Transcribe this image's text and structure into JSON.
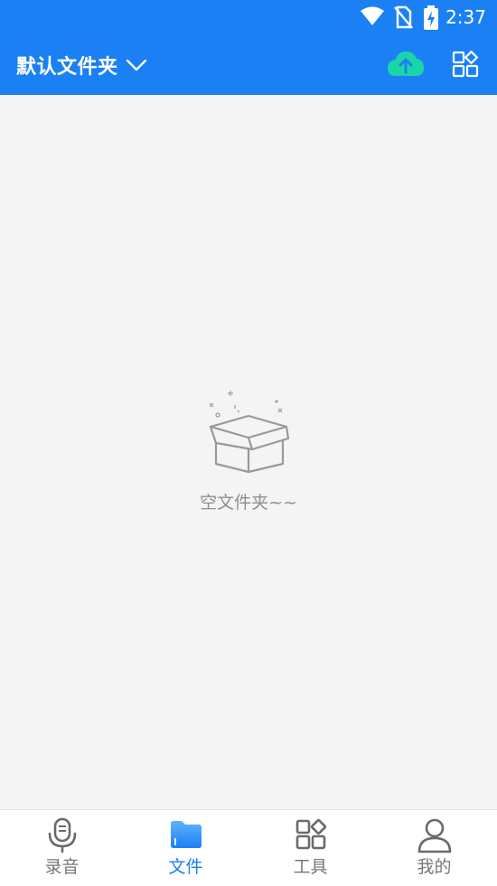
{
  "status_bar": {
    "time": "2:37",
    "icons": [
      "wifi-icon",
      "no-sim-icon",
      "battery-charging-icon"
    ]
  },
  "app_bar": {
    "folder_title": "默认文件夹",
    "actions": [
      {
        "icon": "cloud-upload-icon",
        "color": "#1ad6a6"
      },
      {
        "icon": "apps-grid-icon"
      }
    ]
  },
  "empty_state": {
    "message": "空文件夹~~",
    "icon": "empty-box-icon"
  },
  "bottom_nav": {
    "items": [
      {
        "label": "录音",
        "icon": "microphone-icon",
        "active": false
      },
      {
        "label": "文件",
        "icon": "folder-icon",
        "active": true
      },
      {
        "label": "工具",
        "icon": "tools-grid-icon",
        "active": false
      },
      {
        "label": "我的",
        "icon": "person-icon",
        "active": false
      }
    ]
  },
  "colors": {
    "primary": "#1a80f4",
    "accent": "#1ad6a6",
    "background": "#f4f4f4",
    "inactive": "#777777"
  }
}
